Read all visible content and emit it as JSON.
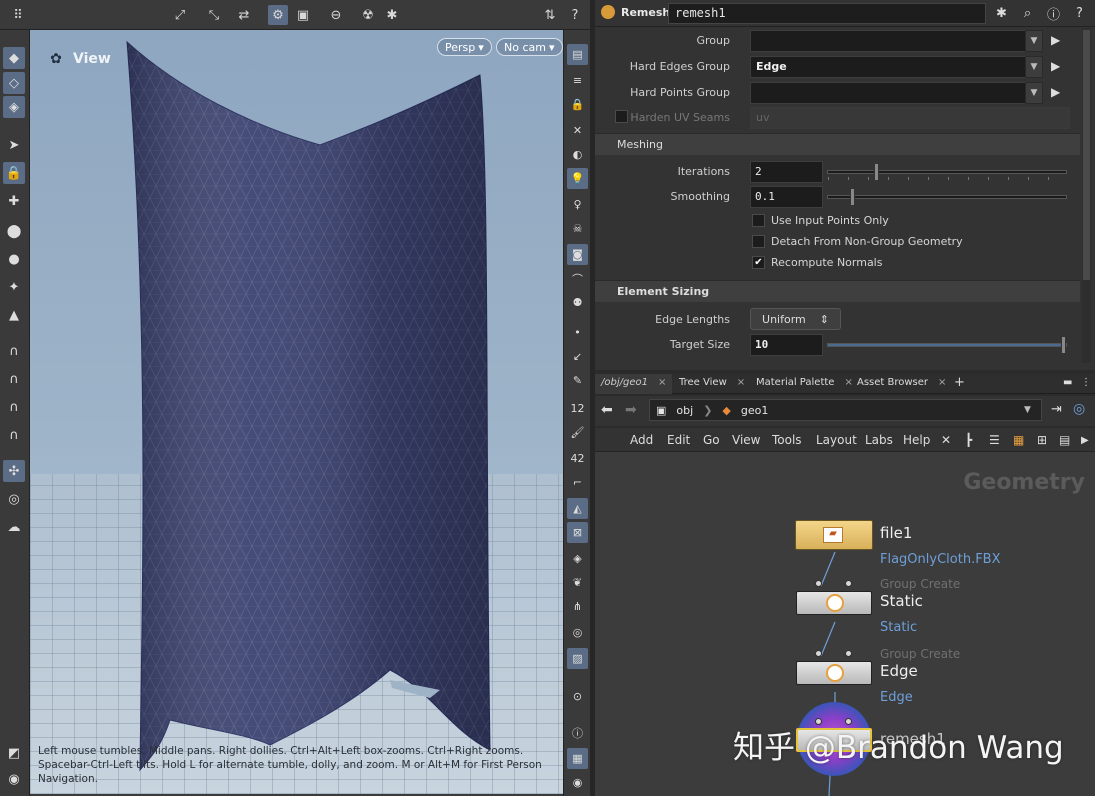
{
  "viewport": {
    "title": "View",
    "persp_label": "Persp",
    "camera_label": "No cam",
    "hint": "Left mouse tumbles. Middle pans. Right dollies. Ctrl+Alt+Left box-zooms. Ctrl+Right zooms. Spacebar-Ctrl-Left tilts. Hold L for alternate tumble, dolly, and zoom. M or Alt+M for First Person Navigation."
  },
  "params": {
    "node_type": "Remesh",
    "node_name": "remesh1",
    "group_label": "Group",
    "group_value": "",
    "hard_edges_label": "Hard Edges Group",
    "hard_edges_value": "Edge",
    "hard_points_label": "Hard Points Group",
    "hard_points_value": "",
    "harden_uv_label": "Harden UV Seams",
    "harden_uv_value": "uv",
    "meshing_section": "Meshing",
    "iterations_label": "Iterations",
    "iterations_value": "2",
    "iterations_fraction": 0.2,
    "smoothing_label": "Smoothing",
    "smoothing_value": "0.1",
    "smoothing_fraction": 0.1,
    "use_input_points_label": "Use Input Points Only",
    "detach_label": "Detach From Non-Group Geometry",
    "recompute_label": "Recompute Normals",
    "recompute_checked": "✔",
    "element_sizing_section": "Element Sizing",
    "edge_lengths_label": "Edge Lengths",
    "edge_lengths_value": "Uniform",
    "target_size_label": "Target Size",
    "target_size_value": "10",
    "target_size_fraction": 1.0
  },
  "network": {
    "tabs": [
      "/obj/geo1",
      "Tree View",
      "Material Palette",
      "Asset Browser"
    ],
    "path_root": "obj",
    "path_child": "geo1",
    "menu": [
      "Add",
      "Edit",
      "Go",
      "View",
      "Tools",
      "Layout",
      "Labs",
      "Help"
    ],
    "context_label": "Geometry",
    "nodes": [
      {
        "name": "file1",
        "sub": "FlagOnlyCloth.FBX",
        "type": ""
      },
      {
        "name": "Static",
        "sub": "Static",
        "type": "Group Create"
      },
      {
        "name": "Edge",
        "sub": "Edge",
        "type": "Group Create"
      },
      {
        "name": "remesh1",
        "sub": "",
        "type": ""
      }
    ]
  },
  "watermark": "知乎 @Brandon Wang",
  "colors": {
    "cloth": "#3b4270",
    "viewport_sky": "#9db3c8",
    "accent_blue": "#6e9fd8",
    "node_highlight": "#e6c43a"
  },
  "icons": {
    "top_bar": [
      "grid-icon",
      "rotate-icon",
      "handle-icon",
      "snap-icon",
      "render-icon",
      "record-icon",
      "display-icon",
      "help-icon"
    ],
    "left_toolbar": [
      "select-icon",
      "lock-icon",
      "transform-icon",
      "magnet-icon"
    ],
    "right_toolbar": [
      "lock-icon",
      "light-icon",
      "camera-icon",
      "info-icon"
    ]
  }
}
